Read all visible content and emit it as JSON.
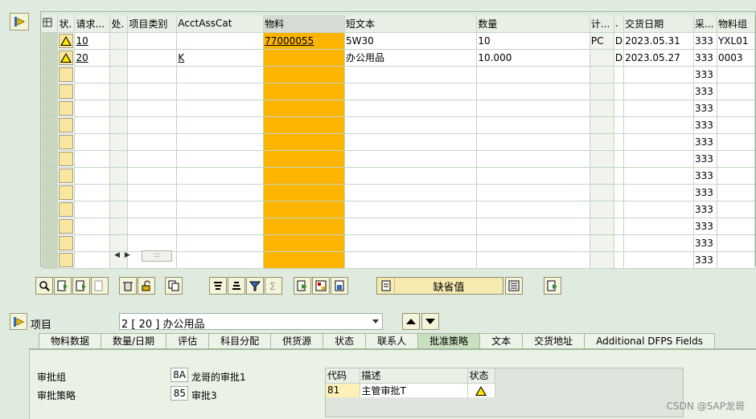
{
  "grid": {
    "headers": [
      "状.",
      "请求...",
      "处.",
      "项目类别",
      "AcctAssCat",
      "物料",
      "短文本",
      "数量",
      "计...",
      ".",
      "交货日期",
      "采...",
      "物料组"
    ],
    "rows": [
      {
        "item": "10",
        "acct": "",
        "material": "77000055",
        "short_text": "5W30",
        "qty": "10",
        "unit": "PC",
        "d": "D",
        "date": "2023.05.31",
        "purch": "333",
        "matgrp": "YXL01"
      },
      {
        "item": "20",
        "acct": "K",
        "material": "",
        "short_text": "办公用品",
        "qty": "10.000",
        "unit": "",
        "d": "D",
        "date": "2023.05.27",
        "purch": "333",
        "matgrp": "0003"
      }
    ],
    "empty_row_value": "333"
  },
  "toolbar": {
    "default_label": "缺省值"
  },
  "item": {
    "label": "项目",
    "selected": "2 [ 20 ] 办公用品"
  },
  "tabs": [
    "物料数据",
    "数量/日期",
    "评估",
    "科目分配",
    "供货源",
    "状态",
    "联系人",
    "批准策略",
    "文本",
    "交货地址",
    "Additional DFPS Fields"
  ],
  "approval": {
    "group_label": "审批组",
    "group_code": "8A",
    "group_text": "龙哥的审批1",
    "strategy_label": "审批策略",
    "strategy_code": "85",
    "strategy_text": "审批3"
  },
  "release_table": {
    "headers": [
      "代码",
      "描述",
      "状态"
    ],
    "rows": [
      {
        "code": "81",
        "desc": "主管审批T"
      }
    ]
  },
  "watermark": "CSDN @SAP龙哥"
}
